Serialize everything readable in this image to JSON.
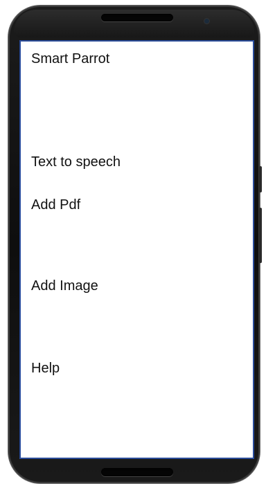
{
  "app": {
    "title": "Smart Parrot"
  },
  "menu": {
    "items": [
      {
        "label": "Text to speech"
      },
      {
        "label": "Add Pdf"
      },
      {
        "label": "Add Image"
      },
      {
        "label": "Help"
      }
    ]
  },
  "colors": {
    "screen_border": "#2a4c9a",
    "phone_body": "#111111",
    "text": "#111111"
  }
}
